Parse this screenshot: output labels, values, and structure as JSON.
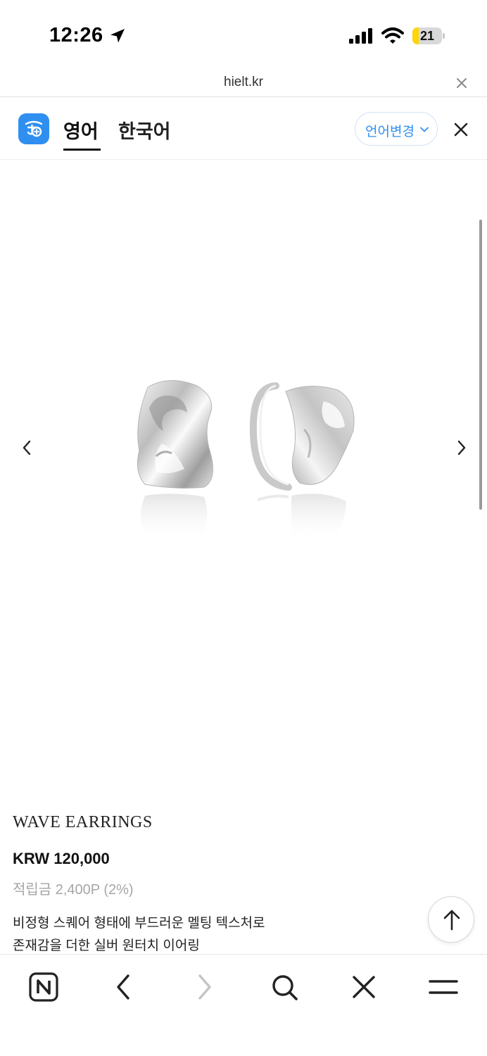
{
  "status_bar": {
    "time": "12:26",
    "battery_level": "21",
    "battery_fraction": 0.21
  },
  "browser": {
    "url": "hielt.kr"
  },
  "translator": {
    "tab_source": "영어",
    "tab_target": "한국어",
    "change_language_label": "언어변경",
    "accent_color": "#2f8ff0"
  },
  "product": {
    "name": "WAVE EARRINGS",
    "price": "KRW 120,000",
    "points": "적립금 2,400P (2%)",
    "description_lines": [
      "비정형 스퀘어 형태에 부드러운 멜팅 텍스처로",
      "존재감을 더한 실버 원터치 이어링"
    ]
  },
  "icons": {
    "status": [
      "location-arrow-icon",
      "signal-icon",
      "wifi-icon",
      "battery-icon"
    ],
    "carousel": [
      "chevron-left-icon",
      "chevron-right-icon"
    ],
    "bottom_nav": [
      "naver-n-icon",
      "back-icon",
      "forward-icon",
      "search-icon",
      "close-icon",
      "menu-icon"
    ],
    "scroll_top": "arrow-up-icon"
  }
}
